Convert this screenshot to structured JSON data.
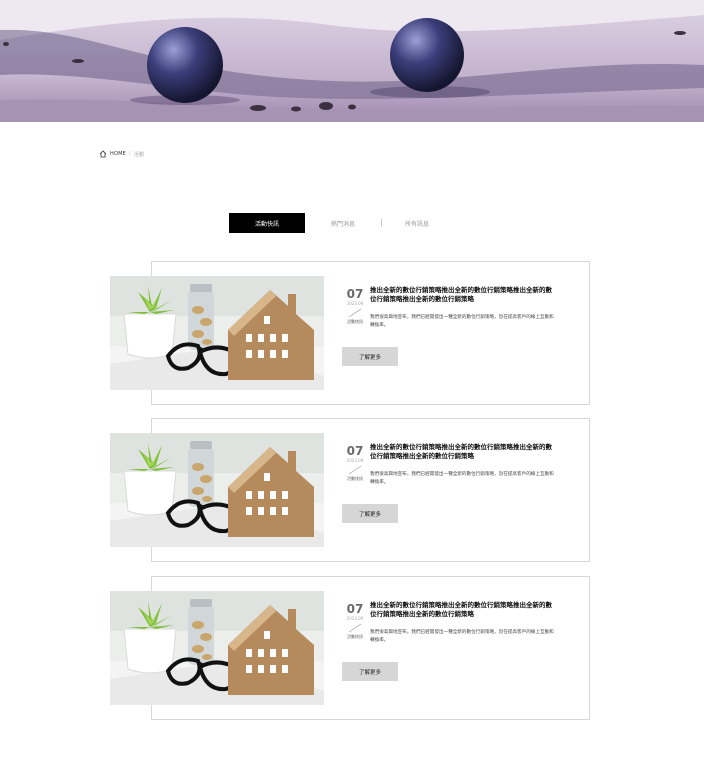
{
  "breadcrumb": {
    "home": "HOME",
    "separator": "/",
    "current": "活動"
  },
  "tabs": [
    {
      "label": "活動快訊",
      "active": true
    },
    {
      "label": "熱門消息",
      "active": false
    },
    {
      "label": "所有訊息",
      "active": false
    }
  ],
  "posts": [
    {
      "day": "07",
      "year_month": "2023.09",
      "category": "活動快訊",
      "title": "推出全新的數位行銷策略推出全新的數位行銷策略推出全新的數位行銷策略推出全新的數位行銷策略",
      "description": "我們很高興地宣布，我們已經開發出一種全新的數位行銷策略，旨在提高客戶的線上互動和轉換率。",
      "button": "了解更多"
    },
    {
      "day": "07",
      "year_month": "2023.09",
      "category": "活動快訊",
      "title": "推出全新的數位行銷策略推出全新的數位行銷策略推出全新的數位行銷策略推出全新的數位行銷策略",
      "description": "我們很高興地宣布，我們已經開發出一種全新的數位行銷策略，旨在提高客戶的線上互動和轉換率。",
      "button": "了解更多"
    },
    {
      "day": "07",
      "year_month": "2023.09",
      "category": "活動快訊",
      "title": "推出全新的數位行銷策略推出全新的數位行銷策略推出全新的數位行銷策略推出全新的數位行銷策略",
      "description": "我們很高興地宣布，我們已經開發出一種全新的數位行銷策略，旨在提高客戶的線上互動和轉換率。",
      "button": "了解更多"
    }
  ],
  "icons": {
    "breadcrumb": "home-icon"
  },
  "colors": {
    "active_tab": "#000000",
    "button": "#d6d6d6",
    "card_border": "#d8d8d8"
  }
}
